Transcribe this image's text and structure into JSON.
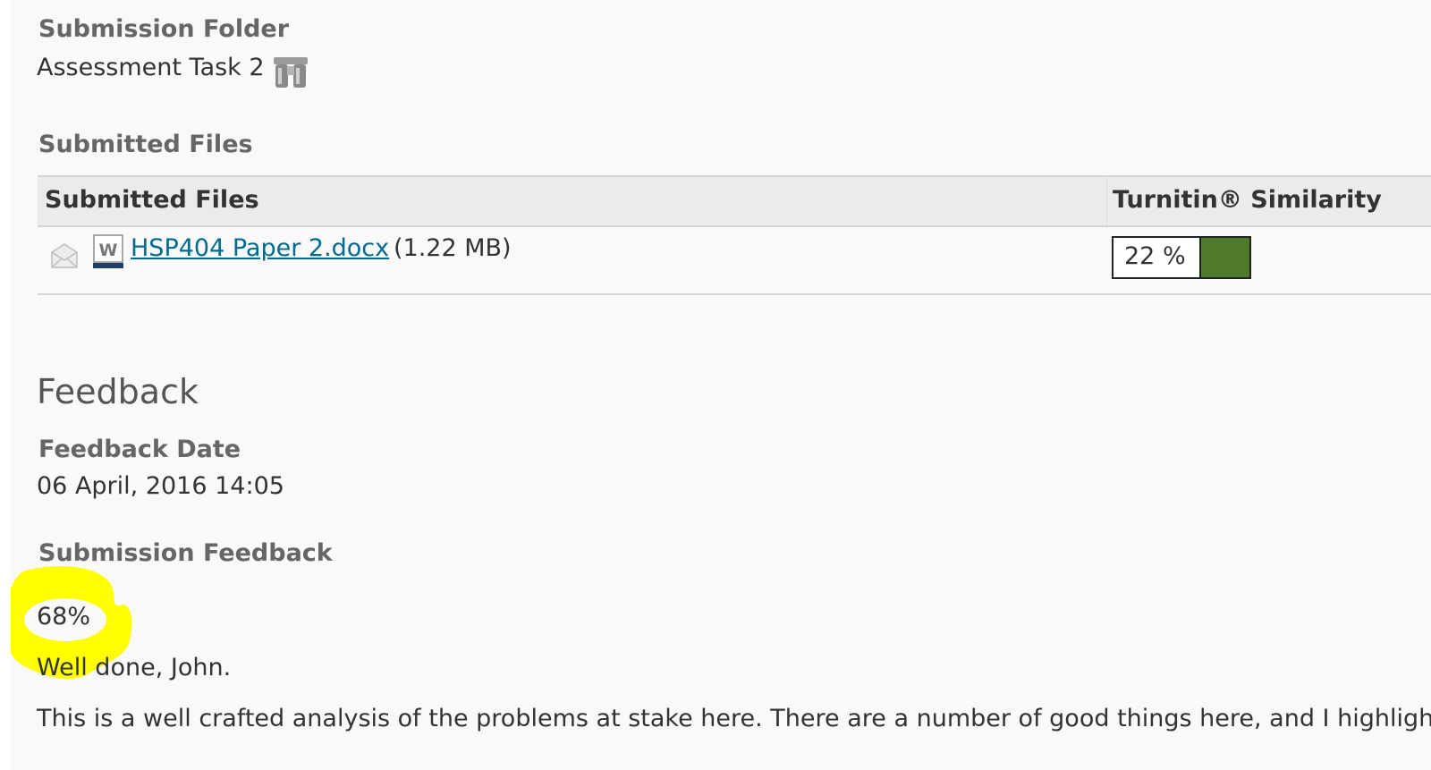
{
  "submission_folder": {
    "label": "Submission Folder",
    "value": "Assessment Task 2",
    "icon": "binoculars-icon"
  },
  "submitted_files_section": {
    "label": "Submitted Files",
    "columns": [
      "Submitted Files",
      "Turnitin® Similarity"
    ],
    "rows": [
      {
        "status_icon": "envelope-icon",
        "file_icon": "word-document-icon",
        "file_name": "HSP404 Paper 2.docx",
        "file_size": "(1.22 MB)",
        "similarity": {
          "text": "22 %",
          "value_percent": 22,
          "color": "#4e7a2a"
        }
      }
    ]
  },
  "feedback": {
    "heading": "Feedback",
    "date_label": "Feedback Date",
    "date_value": "06 April, 2016 14:05",
    "submission_feedback_label": "Submission Feedback",
    "grade": "68%",
    "highlight_color": "#ffff00",
    "greeting": "Well done, John.",
    "body": "This is a well crafted analysis of the problems at stake here. There are a number of good things here, and I highligh"
  }
}
